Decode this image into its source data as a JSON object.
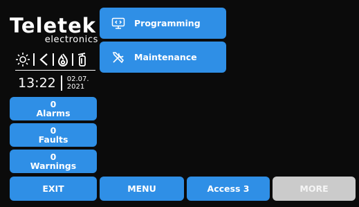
{
  "brand": {
    "logo": "Teletek",
    "sub": "electronics"
  },
  "status_icons": [
    "sun-icon",
    "speaker-icon",
    "fire-icon",
    "extinguisher-icon"
  ],
  "clock": {
    "time": "13:22",
    "date_line1": "02.07.",
    "date_line2": "2021"
  },
  "counters": [
    {
      "count": "0",
      "label": "Alarms"
    },
    {
      "count": "0",
      "label": "Faults"
    },
    {
      "count": "0",
      "label": "Warnings"
    }
  ],
  "menu": [
    {
      "label": "Programming",
      "icon": "programming-monitor-icon"
    },
    {
      "label": "Maintenance",
      "icon": "tools-icon"
    }
  ],
  "bottom_bar": {
    "exit": "EXIT",
    "menu": "MENU",
    "access": "Access 3",
    "more": "MORE"
  },
  "colors": {
    "button": "#2f8fe6",
    "disabled": "#cbcbcb",
    "background": "#0b0b0b"
  }
}
